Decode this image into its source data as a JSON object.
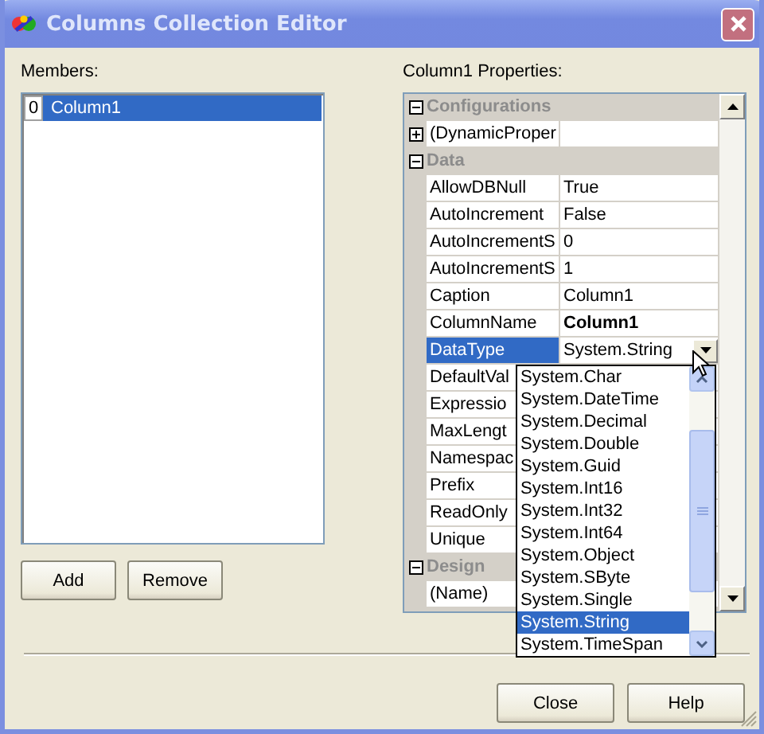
{
  "window": {
    "title": "Columns Collection Editor"
  },
  "members": {
    "label": "Members:",
    "items": [
      {
        "index": "0",
        "name": "Column1",
        "selected": true
      }
    ]
  },
  "member_buttons": [
    "Add",
    "Remove"
  ],
  "properties": {
    "label": "Column1 Properties:",
    "rows": [
      {
        "kind": "category",
        "name": "Configurations",
        "expanded": true
      },
      {
        "kind": "expandable",
        "name": "(DynamicProper",
        "expanded": false,
        "selected": false
      },
      {
        "kind": "category",
        "name": "Data",
        "expanded": true
      },
      {
        "kind": "property",
        "name": "AllowDBNull",
        "value": "True",
        "modified": false,
        "selected": false
      },
      {
        "kind": "property",
        "name": "AutoIncrement",
        "value": "False",
        "modified": false,
        "selected": false
      },
      {
        "kind": "property",
        "name": "AutoIncrementS",
        "value": "0",
        "modified": false,
        "selected": false
      },
      {
        "kind": "property",
        "name": "AutoIncrementS",
        "value": "1",
        "modified": false,
        "selected": false
      },
      {
        "kind": "property",
        "name": "Caption",
        "value": "Column1",
        "modified": false,
        "selected": false
      },
      {
        "kind": "property",
        "name": "ColumnName",
        "value": "Column1",
        "modified": true,
        "selected": false
      },
      {
        "kind": "dropdown",
        "name": "DataType",
        "value": "System.String",
        "modified": false,
        "selected": true
      },
      {
        "kind": "property",
        "name": "DefaultVal",
        "selected": false
      },
      {
        "kind": "property",
        "name": "Expressio",
        "selected": false
      },
      {
        "kind": "property",
        "name": "MaxLengt",
        "selected": false
      },
      {
        "kind": "property",
        "name": "Namespac",
        "selected": false
      },
      {
        "kind": "property",
        "name": "Prefix",
        "selected": false
      },
      {
        "kind": "property",
        "name": "ReadOnly",
        "selected": false
      },
      {
        "kind": "property",
        "name": "Unique",
        "selected": false
      },
      {
        "kind": "category",
        "name": "Design",
        "expanded": true
      },
      {
        "kind": "property",
        "name": "(Name)",
        "selected": false
      }
    ]
  },
  "dropdown": {
    "items": [
      {
        "label": "System.Char",
        "selected": false
      },
      {
        "label": "System.DateTime",
        "selected": false
      },
      {
        "label": "System.Decimal",
        "selected": false
      },
      {
        "label": "System.Double",
        "selected": false
      },
      {
        "label": "System.Guid",
        "selected": false
      },
      {
        "label": "System.Int16",
        "selected": false
      },
      {
        "label": "System.Int32",
        "selected": false
      },
      {
        "label": "System.Int64",
        "selected": false
      },
      {
        "label": "System.Object",
        "selected": false
      },
      {
        "label": "System.SByte",
        "selected": false
      },
      {
        "label": "System.Single",
        "selected": false
      },
      {
        "label": "System.String",
        "selected": true
      },
      {
        "label": "System.TimeSpan",
        "selected": false
      }
    ]
  },
  "dialog_buttons": [
    "Close",
    "Help"
  ]
}
